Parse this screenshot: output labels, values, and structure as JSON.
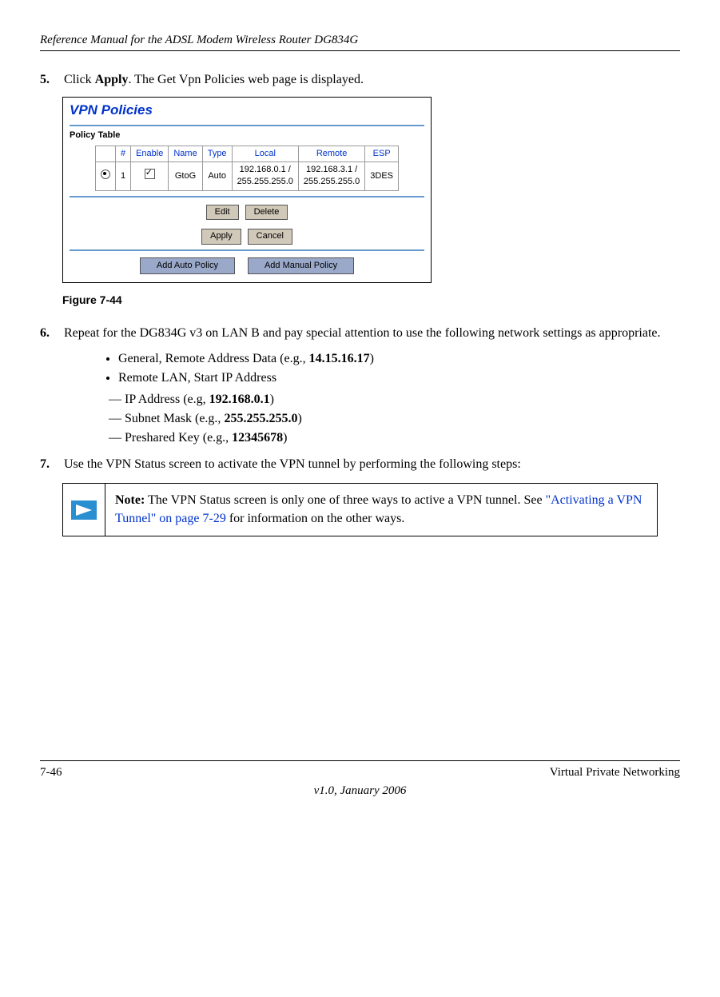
{
  "header": {
    "title": "Reference Manual for the ADSL Modem Wireless Router DG834G"
  },
  "steps": {
    "s5": {
      "num": "5.",
      "text_a": "Click ",
      "bold": "Apply",
      "text_b": ". The Get Vpn Policies web page is displayed."
    },
    "s6": {
      "num": "6.",
      "text": "Repeat for the DG834G v3 on LAN B and pay special attention to use the following network settings as appropriate."
    },
    "s7": {
      "num": "7.",
      "text": "Use the VPN Status screen to activate the VPN tunnel by performing the following steps:"
    }
  },
  "screenshot": {
    "title": "VPN Policies",
    "pt_label": "Policy Table",
    "headers": {
      "num": "#",
      "enable": "Enable",
      "name": "Name",
      "type": "Type",
      "local": "Local",
      "remote": "Remote",
      "esp": "ESP"
    },
    "row": {
      "num": "1",
      "name": "GtoG",
      "type": "Auto",
      "local_a": "192.168.0.1 /",
      "local_b": "255.255.255.0",
      "remote_a": "192.168.3.1 /",
      "remote_b": "255.255.255.0",
      "esp": "3DES"
    },
    "buttons": {
      "edit": "Edit",
      "delete": "Delete",
      "apply": "Apply",
      "cancel": "Cancel",
      "add_auto": "Add Auto Policy",
      "add_manual": "Add Manual Policy"
    }
  },
  "figure_label": "Figure 7-44",
  "bullets": {
    "b1_a": "General, Remote Address Data (e.g., ",
    "b1_bold": "14.15.16.17",
    "b1_b": ")",
    "b2": "Remote LAN, Start IP Address"
  },
  "dashes": {
    "d1_a": "IP Address (e.g, ",
    "d1_bold": "192.168.0.1",
    "d1_b": ")",
    "d2_a": "Subnet Mask (e.g., ",
    "d2_bold": "255.255.255.0",
    "d2_b": ")",
    "d3_a": "Preshared Key (e.g., ",
    "d3_bold": "12345678",
    "d3_b": ")"
  },
  "note": {
    "bold": "Note:",
    "text_a": " The VPN Status screen is only one of three ways to active a VPN tunnel. See ",
    "link": "\"Activating a VPN Tunnel\" on page 7-29",
    "text_b": " for information on the other ways."
  },
  "footer": {
    "page": "7-46",
    "section": "Virtual Private Networking",
    "version": "v1.0, January 2006"
  }
}
